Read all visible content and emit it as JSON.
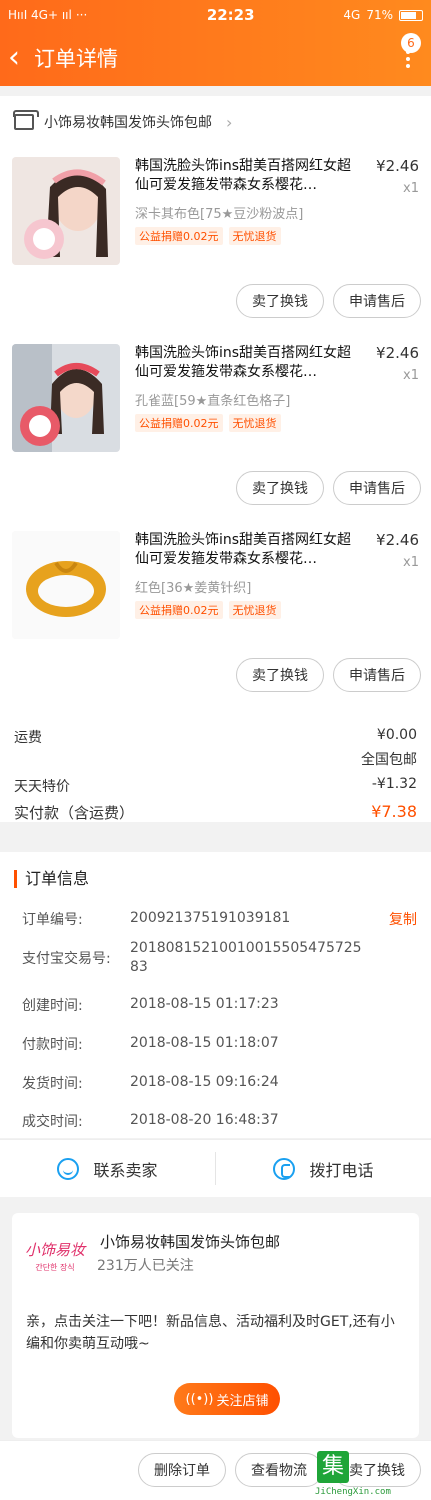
{
  "status": {
    "left": "HııI 4G+ ııl",
    "time": "22:23",
    "net": "4G",
    "battery": "71%"
  },
  "nav": {
    "title": "订单详情",
    "badge": "6"
  },
  "shop": {
    "name": "小饰易妆韩国发饰头饰包邮"
  },
  "items": [
    {
      "title": "韩国洗脸头饰ins甜美百搭网红女超仙可爱发箍发带森女系樱花…",
      "price": "¥2.46",
      "qty": "x1",
      "spec": "深卡其布色[75★豆沙粉波点]",
      "tag1": "公益捐赠0.02元",
      "tag2": "无忧退货",
      "btn1": "卖了换钱",
      "btn2": "申请售后"
    },
    {
      "title": "韩国洗脸头饰ins甜美百搭网红女超仙可爱发箍发带森女系樱花…",
      "price": "¥2.46",
      "qty": "x1",
      "spec": "孔雀蓝[59★直条红色格子]",
      "tag1": "公益捐赠0.02元",
      "tag2": "无忧退货",
      "btn1": "卖了换钱",
      "btn2": "申请售后"
    },
    {
      "title": "韩国洗脸头饰ins甜美百搭网红女超仙可爱发箍发带森女系樱花…",
      "price": "¥2.46",
      "qty": "x1",
      "spec": "红色[36★姜黄针织]",
      "tag1": "公益捐赠0.02元",
      "tag2": "无忧退货",
      "btn1": "卖了换钱",
      "btn2": "申请售后"
    }
  ],
  "fees": {
    "shipping_label": "运费",
    "shipping_value": "¥0.00",
    "shipping_note": "全国包邮",
    "special_label": "天天特价",
    "special_value": "-¥1.32",
    "paid_label": "实付款（含运费）",
    "paid_value": "¥7.38"
  },
  "order_info": {
    "title": "订单信息",
    "rows": [
      {
        "label": "订单编号:",
        "value": "200921375191039181"
      },
      {
        "label": "支付宝交易号:",
        "value": "2018081521001001550547572583"
      },
      {
        "label": "创建时间:",
        "value": "2018-08-15 01:17:23"
      },
      {
        "label": "付款时间:",
        "value": "2018-08-15 01:18:07"
      },
      {
        "label": "发货时间:",
        "value": "2018-08-15 09:16:24"
      },
      {
        "label": "成交时间:",
        "value": "2018-08-20 16:48:37"
      }
    ],
    "copy": "复制"
  },
  "contact": {
    "seller": "联系卖家",
    "call": "拨打电话"
  },
  "store": {
    "logo_line1": "小饰易妆",
    "logo_line2": "간단한 장식",
    "name": "小饰易妆韩国发饰头饰包邮",
    "fans": "231万人已关注",
    "desc": "亲，点击关注一下吧！新品信息、活动福利及时GET,还有小编和你卖萌互动哦~",
    "follow": "关注店铺"
  },
  "bottom": {
    "delete": "删除订单",
    "logistics": "查看物流",
    "sell": "卖了换钱"
  },
  "watermark": {
    "mark": "集",
    "site": "JiChengXin.com"
  },
  "colors": {
    "accent": "#ff5000",
    "header": "#ff7a1a",
    "link_blue": "#1aa0f0"
  }
}
